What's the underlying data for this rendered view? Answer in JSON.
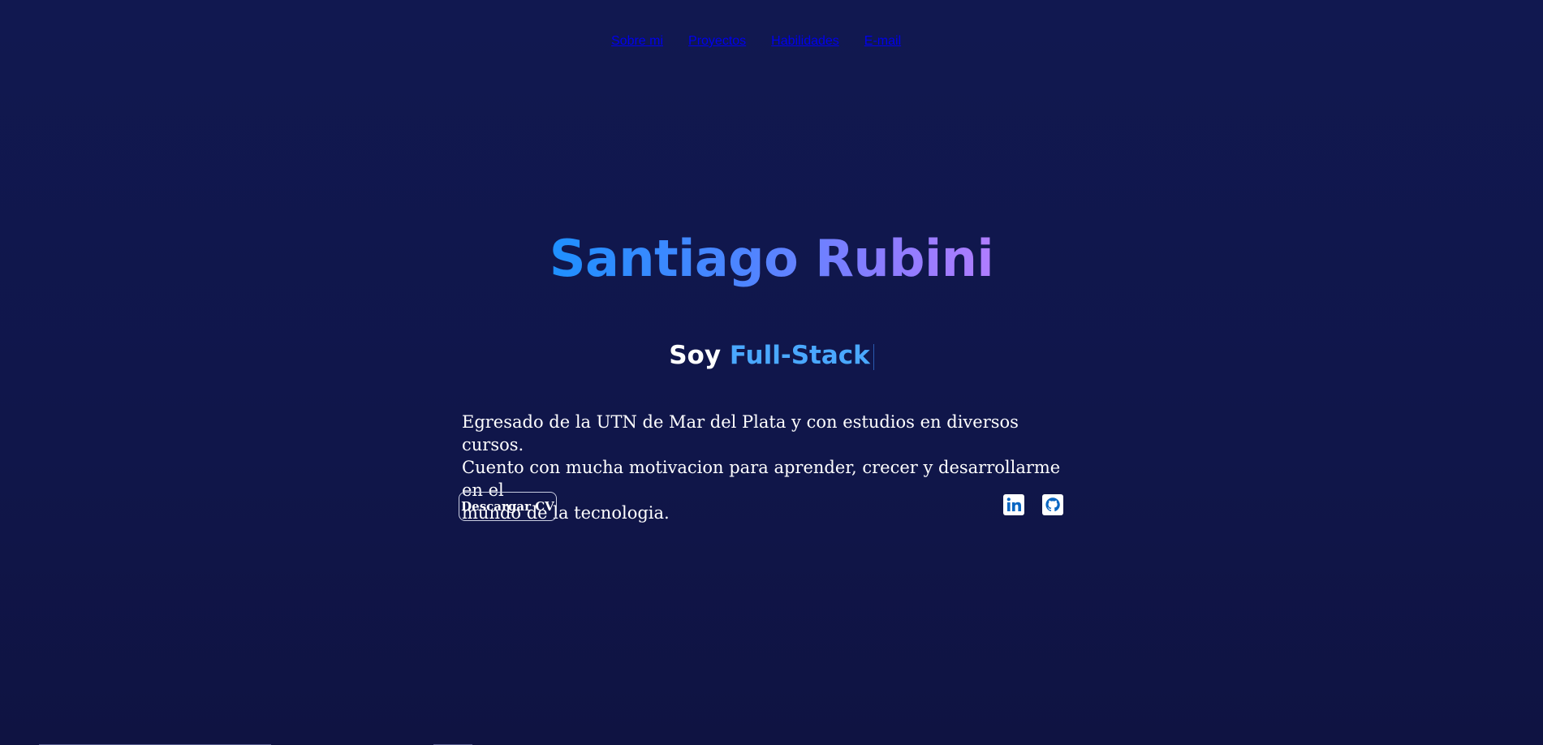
{
  "nav": {
    "items": [
      "Sobre mi",
      "Proyectos",
      "Habilidades",
      "E-mail"
    ]
  },
  "hero": {
    "name": "Santiago Rubini",
    "subtitle_prefix": "Soy",
    "subtitle_role": "Full-Stack"
  },
  "bio": {
    "lines": [
      "Egresado de la UTN de Mar del Plata y con estudios en diversos cursos.",
      "Cuento con mucha motivacion para aprender, crecer y desarrollarme en el",
      "mundo de la tecnologia."
    ]
  },
  "actions": {
    "cv_label": "Descargar CV"
  },
  "social": {
    "icons": [
      "linkedin-icon",
      "github-icon"
    ]
  },
  "colors": {
    "background": "#111850",
    "name_gradient_start": "#1e90ff",
    "name_gradient_end": "#b07dff",
    "role": "#4aa8ff",
    "icon_blue": "#0a66c2"
  }
}
